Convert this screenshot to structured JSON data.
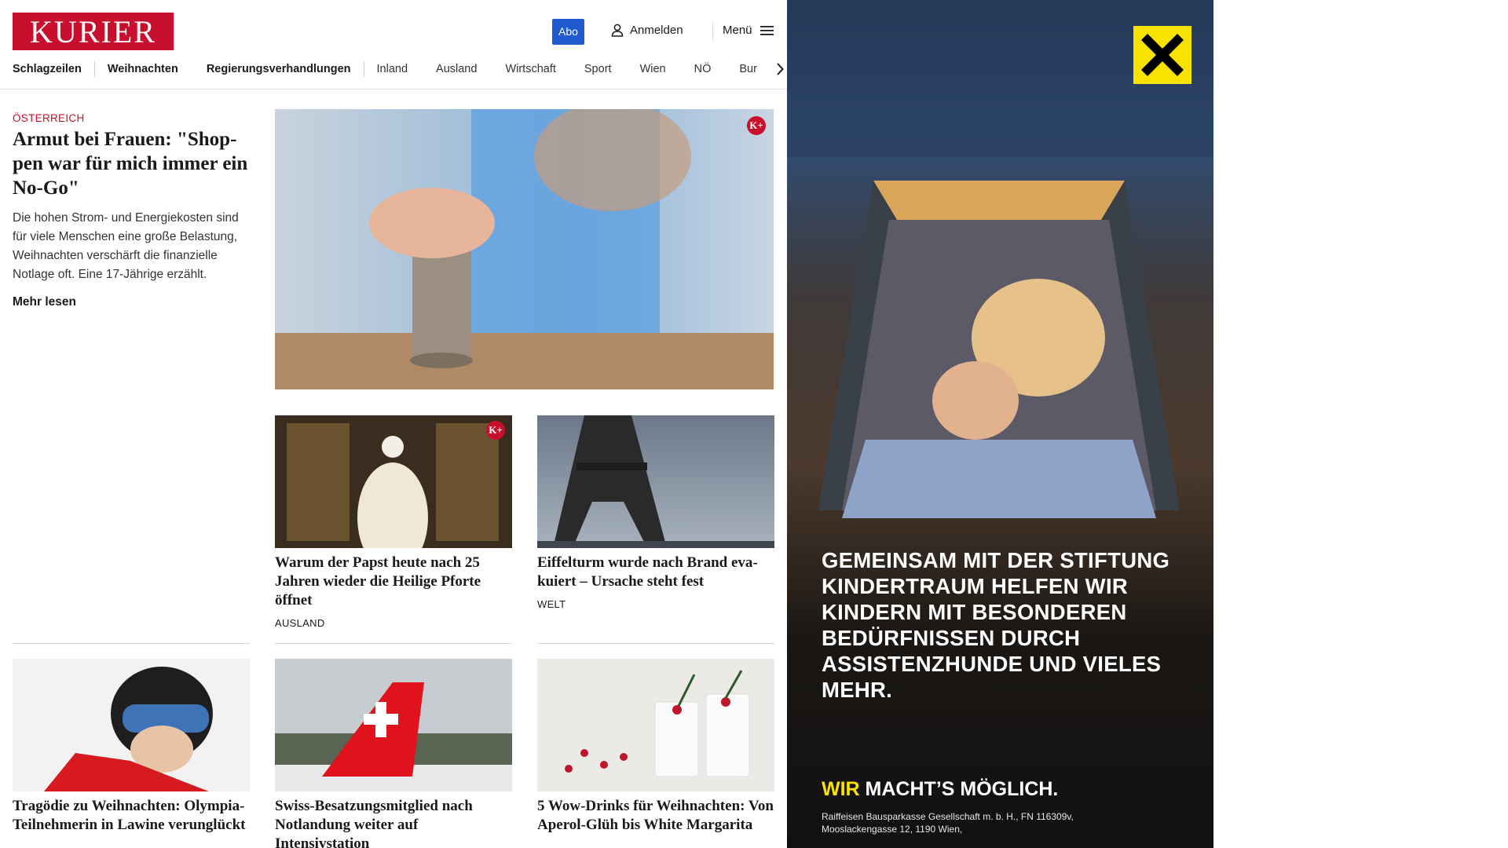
{
  "header": {
    "logo_text": "KURIER",
    "abo_label": "Abo",
    "login_label": "Anmelden",
    "menu_label": "Menü"
  },
  "nav": {
    "items": [
      "Schlagzeilen",
      "Weihnachten",
      "Regierungsverhandlungen",
      "Inland",
      "Ausland",
      "Wirtschaft",
      "Sport",
      "Wien",
      "NÖ",
      "Bur"
    ]
  },
  "lead": {
    "kicker": "ÖSTERREICH",
    "title": "Armut bei Frauen: \"Shop­pen war für mich immer ein No-Go\"",
    "teaser": "Die hohen Strom- und Energiekosten sind für viele Menschen eine große Belastung, Weihnachten verschärft die finanzielle Notlage oft. Eine 17-Jährige erzählt.",
    "more_label": "Mehr lesen",
    "premium_badge": "K+"
  },
  "cards": [
    {
      "title": "Warum der Papst heute nach 25 Jahren wieder die Heilige Pforte öffnet",
      "section": "AUSLAND",
      "premium_badge": "K+"
    },
    {
      "title": "Eiffelturm wurde nach Brand eva­kuiert – Ursache steht fest",
      "section": "WELT"
    },
    {
      "title": "Tragödie zu Weihnachten: Olym­pia-Teilnehmerin in Lawine verunglückt"
    },
    {
      "title": "Swiss-Besatzungsmitglied nach Notlandung weiter auf Intensivstation"
    },
    {
      "title": "5 Wow-Drinks für Weihnachten: Von Aperol-Glüh bis White Margarita"
    }
  ],
  "ad": {
    "headline": "Gemeinsam mit der Stiftung Kindertraum helfen wir Kindern mit besonderen Bedürfnissen durch Assistenzhunde und vieles mehr.",
    "claim_highlight": "WIR",
    "claim_rest": " MACHT’S MÖGLICH.",
    "legal": "Raiffeisen Bausparkasse Gesellschaft m. b. H., FN 116309v, Mooslackengasse 12, 1190 Wien,"
  },
  "colors": {
    "brand_red": "#c8102e",
    "abo_blue": "#1f5ad1",
    "ad_yellow": "#f7e200"
  }
}
